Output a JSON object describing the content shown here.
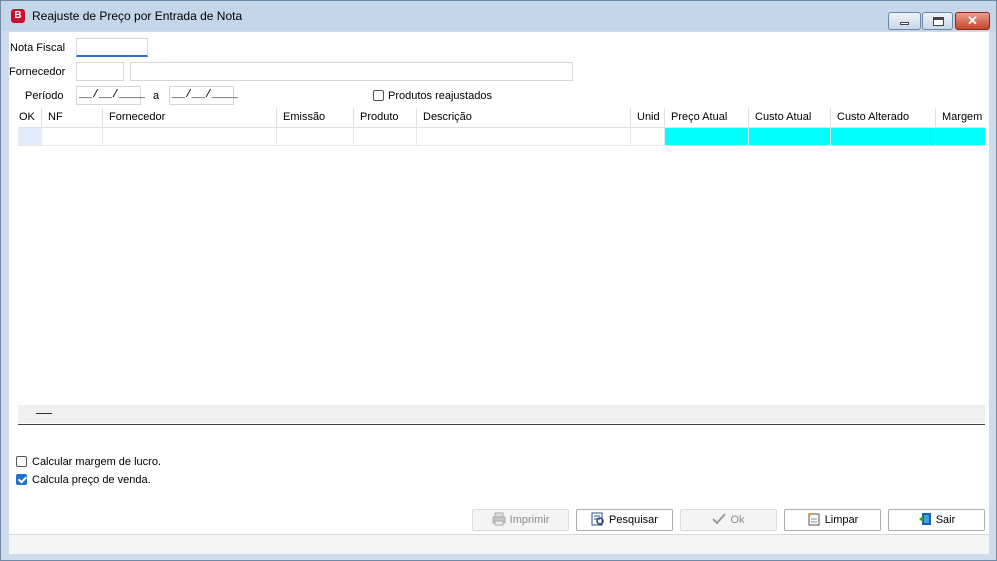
{
  "window": {
    "icon_letter": "B",
    "title": "Reajuste de Preço por Entrada de Nota",
    "minimize_glyph": "",
    "maximize_glyph": "",
    "close_glyph": "✕"
  },
  "filters": {
    "nota_fiscal_label": "Nota Fiscal",
    "nota_fiscal_value": "",
    "fornecedor_label": "Fornecedor",
    "fornecedor_code": "",
    "fornecedor_name": "",
    "periodo_label": "Período",
    "periodo_start": "__/__/____",
    "periodo_sep": "a",
    "periodo_end": "__/__/____",
    "produtos_reajustados_label": "Produtos reajustados",
    "produtos_reajustados_checked": false
  },
  "grid": {
    "columns": [
      "OK",
      "NF",
      "Fornecedor",
      "Emissão",
      "Produto",
      "Descrição",
      "Unid",
      "Preço Atual",
      "Custo Atual",
      "Custo Alterado",
      "Margem L"
    ],
    "highlight_color": "#00ffff"
  },
  "options": {
    "calcular_margem_label": "Calcular margem de lucro.",
    "calcular_margem_checked": false,
    "calcula_preco_label": "Calcula preço de venda.",
    "calcula_preco_checked": true
  },
  "buttons": {
    "imprimir": "Imprimir",
    "pesquisar": "Pesquisar",
    "ok": "Ok",
    "limpar": "Limpar",
    "sair": "Sair"
  },
  "icons": {
    "app": "app-b-icon",
    "imprimir": "printer-icon",
    "pesquisar": "search-document-icon",
    "ok": "checkmark-icon",
    "limpar": "clear-document-icon",
    "sair": "exit-door-icon"
  }
}
